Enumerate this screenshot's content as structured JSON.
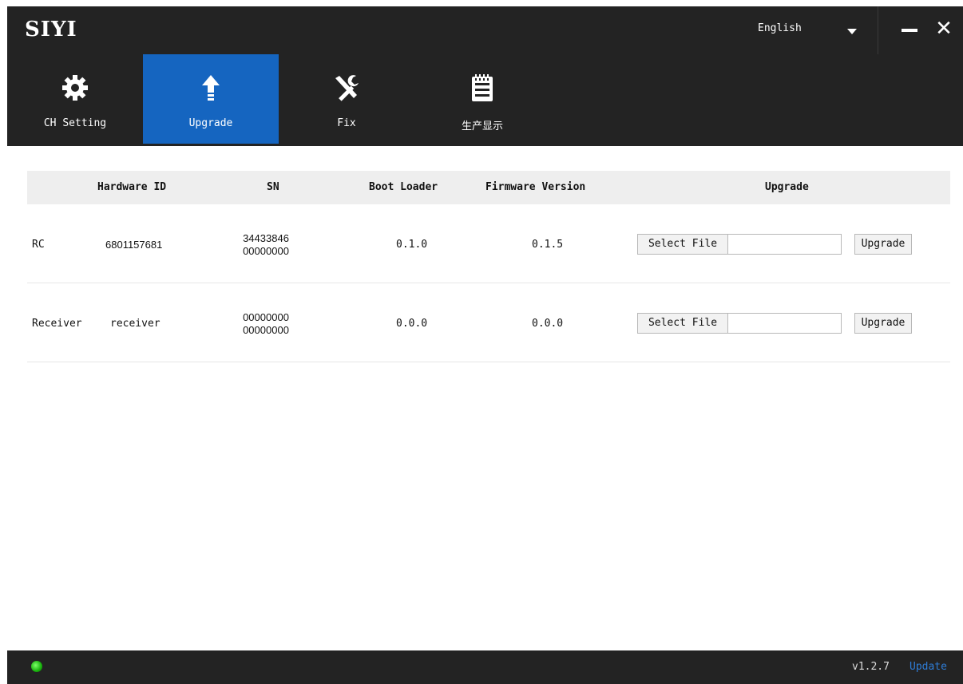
{
  "app": {
    "logo": "SIYI",
    "language": "English",
    "accent_color": "#1565c0"
  },
  "nav": [
    {
      "label": "CH Setting",
      "icon": "gear-icon"
    },
    {
      "label": "Upgrade",
      "icon": "upload-arrow-icon",
      "active": true
    },
    {
      "label": "Fix",
      "icon": "wrench-screwdriver-icon"
    },
    {
      "label": "生产显示",
      "icon": "notepad-icon"
    }
  ],
  "table": {
    "headers": [
      "Hardware ID",
      "SN",
      "Boot Loader",
      "Firmware Version",
      "Upgrade"
    ],
    "rows": [
      {
        "name": "RC",
        "hardware_id": "6801157681",
        "sn_line1": "34433846",
        "sn_line2": "00000000",
        "boot_loader": "0.1.0",
        "firmware": "0.1.5",
        "select_label": "Select File",
        "file_value": "",
        "upgrade_label": "Upgrade"
      },
      {
        "name": "Receiver",
        "hardware_id": "receiver",
        "sn_line1": "00000000",
        "sn_line2": "00000000",
        "boot_loader": "0.0.0",
        "firmware": "0.0.0",
        "select_label": "Select File",
        "file_value": "",
        "upgrade_label": "Upgrade"
      }
    ]
  },
  "status": {
    "connection_color": "#18b10c",
    "version": "v1.2.7",
    "update_label": "Update"
  }
}
